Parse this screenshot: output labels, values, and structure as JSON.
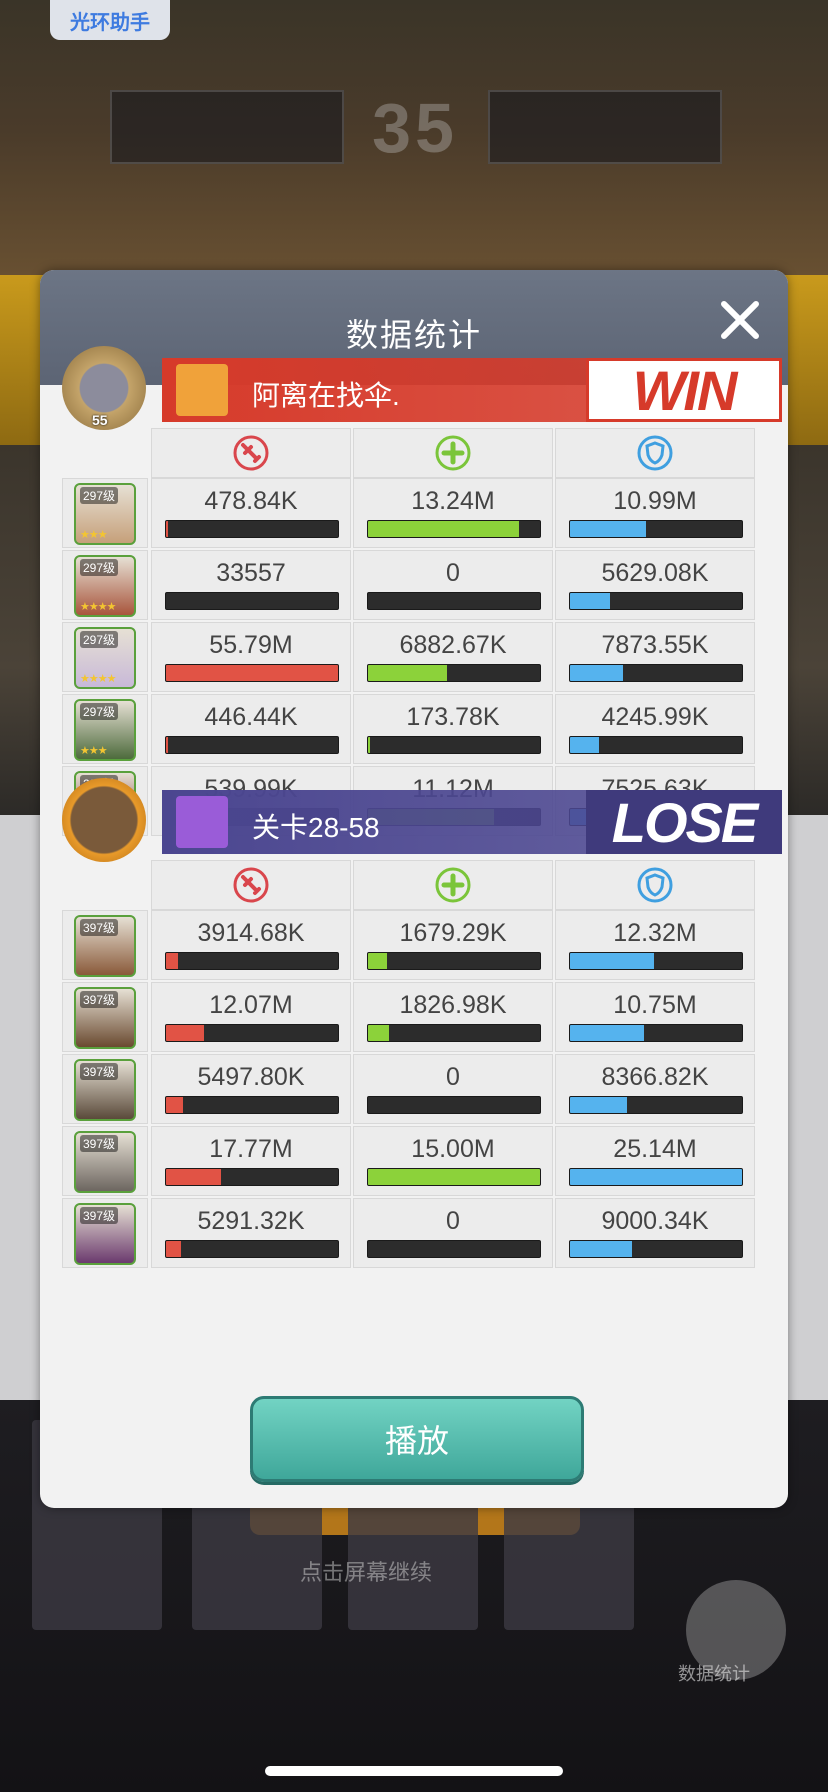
{
  "app_badge": "光环助手",
  "background": {
    "score": "35",
    "hint": "点击屏幕继续",
    "float_button_label": "数据统计"
  },
  "panel": {
    "title": "数据统计",
    "close_icon": "close-icon",
    "play_label": "播放"
  },
  "teams": [
    {
      "name": "阿离在找伞.",
      "result": "WIN",
      "leader_level": "55",
      "banner_color": "#d63a2a",
      "result_color": "#d63a2a",
      "heroes": [
        {
          "level": "297级",
          "stars": "★★★",
          "damage": "478.84K",
          "damage_frac": 0.01,
          "heal": "13.24M",
          "heal_frac": 0.88,
          "tank": "10.99M",
          "tank_frac": 0.44
        },
        {
          "level": "297级",
          "stars": "★★★★",
          "damage": "33557",
          "damage_frac": 0.0,
          "heal": "0",
          "heal_frac": 0.0,
          "tank": "5629.08K",
          "tank_frac": 0.23
        },
        {
          "level": "297级",
          "stars": "★★★★",
          "damage": "55.79M",
          "damage_frac": 1.0,
          "heal": "6882.67K",
          "heal_frac": 0.46,
          "tank": "7873.55K",
          "tank_frac": 0.31
        },
        {
          "level": "297级",
          "stars": "★★★",
          "damage": "446.44K",
          "damage_frac": 0.01,
          "heal": "173.78K",
          "heal_frac": 0.01,
          "tank": "4245.99K",
          "tank_frac": 0.17
        },
        {
          "level": "297级",
          "stars": "★★★",
          "damage": "539.99K",
          "damage_frac": 0.01,
          "heal": "11.12M",
          "heal_frac": 0.73,
          "tank": "7525.63K",
          "tank_frac": 0.3
        }
      ]
    },
    {
      "name": "关卡28-58",
      "result": "LOSE",
      "banner_color": "#4b4690",
      "result_color": "#3f3a7c",
      "heroes": [
        {
          "level": "397级",
          "stars": "",
          "damage": "3914.68K",
          "damage_frac": 0.07,
          "heal": "1679.29K",
          "heal_frac": 0.11,
          "tank": "12.32M",
          "tank_frac": 0.49
        },
        {
          "level": "397级",
          "stars": "",
          "damage": "12.07M",
          "damage_frac": 0.22,
          "heal": "1826.98K",
          "heal_frac": 0.12,
          "tank": "10.75M",
          "tank_frac": 0.43
        },
        {
          "level": "397级",
          "stars": "",
          "damage": "5497.80K",
          "damage_frac": 0.1,
          "heal": "0",
          "heal_frac": 0.0,
          "tank": "8366.82K",
          "tank_frac": 0.33
        },
        {
          "level": "397级",
          "stars": "",
          "damage": "17.77M",
          "damage_frac": 0.32,
          "heal": "15.00M",
          "heal_frac": 1.0,
          "tank": "25.14M",
          "tank_frac": 1.0
        },
        {
          "level": "397级",
          "stars": "",
          "damage": "5291.32K",
          "damage_frac": 0.09,
          "heal": "0",
          "heal_frac": 0.0,
          "tank": "9000.34K",
          "tank_frac": 0.36
        }
      ]
    }
  ],
  "stat_icons": [
    "sword-icon",
    "heal-cross-icon",
    "shield-icon"
  ],
  "hero_colors": [
    "#c6a07a",
    "#a8553c",
    "#c8b9d8",
    "#4d6b3c",
    "#7a2e2e",
    "#8a5a3a",
    "#6a4a30",
    "#5a4a3a",
    "#6d6660",
    "#6b3a6e"
  ]
}
